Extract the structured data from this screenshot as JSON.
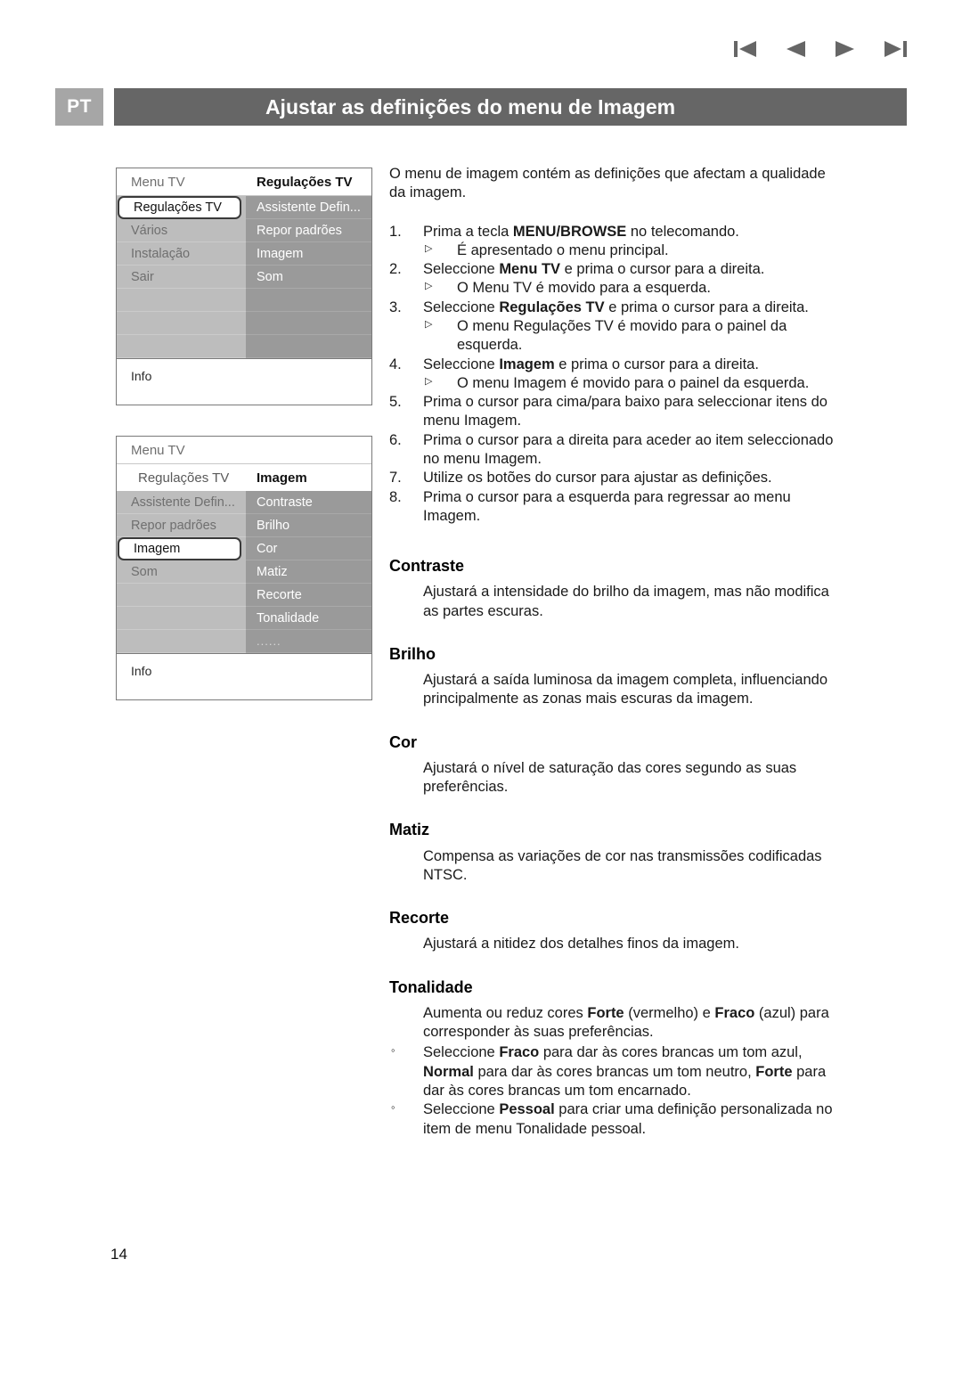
{
  "header": {
    "language_tag": "PT",
    "title": "Ajustar as definições do menu de Imagem",
    "nav_icons": [
      "first-page-icon",
      "previous-page-icon",
      "next-page-icon",
      "last-page-icon"
    ]
  },
  "colors": {
    "title_band": "#666666",
    "lang_tag": "#a6a6a6",
    "menu_left_panel": "#bdbdbd",
    "menu_right_panel": "#9a9a9a",
    "text": "#1a1a1a"
  },
  "tv_menu_1": {
    "header_left": "Menu TV",
    "header_right": "Regulações TV",
    "left_items": [
      {
        "label": "Regulações TV",
        "selected": true
      },
      {
        "label": "Vários",
        "selected": false
      },
      {
        "label": "Instalação",
        "selected": false
      },
      {
        "label": "Sair",
        "selected": false
      },
      {
        "label": "",
        "selected": false
      },
      {
        "label": "",
        "selected": false
      },
      {
        "label": "",
        "selected": false
      }
    ],
    "right_items": [
      {
        "label": "Assistente Defin..."
      },
      {
        "label": "Repor padrões"
      },
      {
        "label": "Imagem"
      },
      {
        "label": "Som"
      },
      {
        "label": ""
      },
      {
        "label": ""
      },
      {
        "label": ""
      }
    ],
    "info": "Info"
  },
  "tv_menu_2": {
    "header_top_left": "Menu TV",
    "header_sub_left": "Regulações TV",
    "header_sub_right": "Imagem",
    "left_items": [
      {
        "label": "Assistente Defin...",
        "selected": false
      },
      {
        "label": "Repor padrões",
        "selected": false
      },
      {
        "label": "Imagem",
        "selected": true
      },
      {
        "label": "Som",
        "selected": false
      },
      {
        "label": "",
        "selected": false
      },
      {
        "label": "",
        "selected": false
      },
      {
        "label": "",
        "selected": false
      }
    ],
    "right_items": [
      {
        "label": "Contraste"
      },
      {
        "label": "Brilho"
      },
      {
        "label": "Cor"
      },
      {
        "label": "Matiz"
      },
      {
        "label": "Recorte"
      },
      {
        "label": "Tonalidade"
      },
      {
        "label": "......"
      }
    ],
    "info": "Info"
  },
  "content": {
    "intro": "O menu de imagem contém as definições que afectam a qualidade da imagem.",
    "steps": [
      {
        "num": "1.",
        "text_html": "Prima a tecla <b>MENU/BROWSE</b> no telecomando.",
        "notes": [
          {
            "marker": "triangle",
            "text_html": "É apresentado o menu principal."
          }
        ]
      },
      {
        "num": "2.",
        "text_html": "Seleccione <b>Menu TV</b> e prima o cursor para a direita.",
        "notes": [
          {
            "marker": "triangle",
            "text_html": "O Menu TV é movido para a esquerda."
          }
        ]
      },
      {
        "num": "3.",
        "text_html": "Seleccione <b>Regulações TV</b> e prima o cursor para a direita.",
        "notes": [
          {
            "marker": "triangle",
            "text_html": "O menu Regulações TV é movido para o painel da esquerda."
          }
        ]
      },
      {
        "num": "4.",
        "text_html": "Seleccione <b>Imagem</b> e prima o cursor para a direita.",
        "notes": [
          {
            "marker": "triangle",
            "text_html": "O menu Imagem é movido para o painel da esquerda."
          }
        ]
      },
      {
        "num": "5.",
        "text_html": "Prima o cursor para cima/para baixo para seleccionar itens do menu Imagem.",
        "notes": []
      },
      {
        "num": "6.",
        "text_html": "Prima o cursor para a direita para aceder ao item seleccionado no menu Imagem.",
        "notes": []
      },
      {
        "num": "7.",
        "text_html": "Utilize os botões do cursor para ajustar as definições.",
        "notes": []
      },
      {
        "num": "8.",
        "text_html": "Prima o cursor para a esquerda para regressar ao menu Imagem.",
        "notes": []
      }
    ],
    "sections": [
      {
        "heading": "Contraste",
        "body_html": "Ajustará a intensidade do brilho da imagem, mas não modifica as partes escuras.",
        "bullets": []
      },
      {
        "heading": "Brilho",
        "body_html": "Ajustará a saída luminosa da imagem completa, influenciando principalmente as zonas mais escuras da imagem.",
        "bullets": []
      },
      {
        "heading": "Cor",
        "body_html": "Ajustará o nível de saturação das cores segundo as suas preferências.",
        "bullets": []
      },
      {
        "heading": "Matiz",
        "body_html": "Compensa as variações de cor nas transmissões codificadas NTSC.",
        "bullets": []
      },
      {
        "heading": "Recorte",
        "body_html": "Ajustará a nitidez dos detalhes finos da imagem.",
        "bullets": []
      },
      {
        "heading": "Tonalidade",
        "body_html": "Aumenta ou reduz cores <b>Forte</b> (vermelho) e <b>Fraco</b> (azul) para corresponder às suas preferências.",
        "bullets": [
          {
            "marker": "circle",
            "text_html": "Seleccione <b>Fraco</b> para dar às cores brancas um tom azul, <b>Normal</b> para dar às cores brancas um tom neutro, <b>Forte</b> para dar às cores brancas um tom encarnado."
          },
          {
            "marker": "circle",
            "text_html": "Seleccione <b>Pessoal</b> para criar uma definição personalizada no item de menu Tonalidade pessoal."
          }
        ]
      }
    ]
  },
  "footer": {
    "page_number": "14"
  }
}
